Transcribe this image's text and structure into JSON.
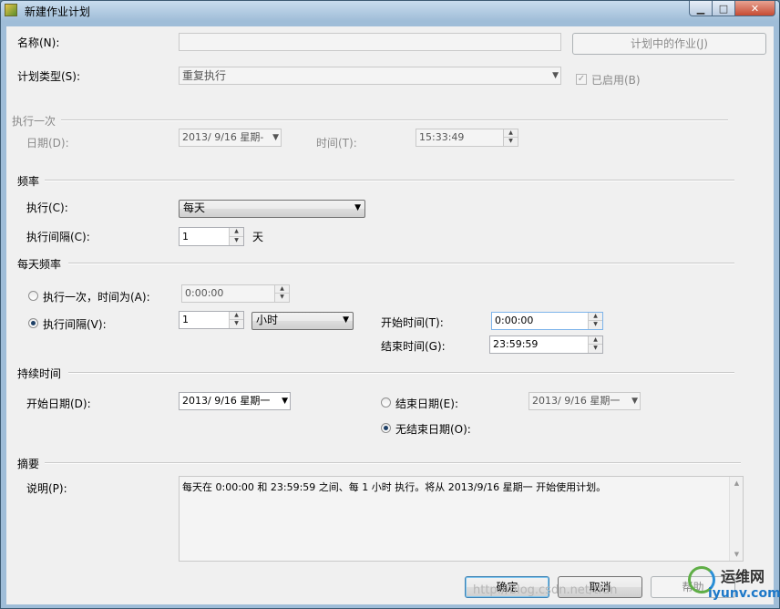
{
  "window": {
    "title": "新建作业计划",
    "minimize": "▁",
    "maximize": "□",
    "close": "✕"
  },
  "general": {
    "name_label": "名称(N):",
    "name_value": "",
    "jobs_button": "计划中的作业(J)",
    "schedule_type_label": "计划类型(S):",
    "schedule_type_value": "重复执行",
    "enabled_label": "已启用(B)",
    "enabled_checked": true
  },
  "once": {
    "section": "执行一次",
    "date_label": "日期(D):",
    "date_value": "2013/ 9/16 星期-",
    "time_label": "时间(T):",
    "time_value": "15:33:49"
  },
  "frequency": {
    "section": "频率",
    "occurs_label": "执行(C):",
    "occurs_value": "每天",
    "recur_label": "执行间隔(C):",
    "recur_value": "1",
    "recur_unit": "天"
  },
  "daily": {
    "section": "每天频率",
    "once_label": "执行一次，时间为(A):",
    "once_value": "0:00:00",
    "every_label": "执行间隔(V):",
    "every_value": "1",
    "every_unit": "小时",
    "start_label": "开始时间(T):",
    "start_value": "0:00:00",
    "end_label": "结束时间(G):",
    "end_value": "23:59:59",
    "selected": "every"
  },
  "duration": {
    "section": "持续时间",
    "start_date_label": "开始日期(D):",
    "start_date_value": "2013/ 9/16 星期一",
    "end_date_label": "结束日期(E):",
    "end_date_value": "2013/ 9/16 星期一",
    "no_end_label": "无结束日期(O):",
    "selected": "no_end"
  },
  "summary": {
    "section": "摘要",
    "desc_label": "说明(P):",
    "desc_value": "每天在 0:00:00 和 23:59:59 之间、每 1 小时 执行。将从 2013/9/16 星期一 开始使用计划。"
  },
  "buttons": {
    "ok": "确定",
    "cancel": "取消",
    "help": "帮助"
  },
  "watermark": {
    "url": "http://blog.csdn.net/tfdn",
    "logo_cn": "运维网",
    "logo_en": "iyunv.com"
  },
  "icons": {
    "app": "app-icon",
    "combo": "combo-arrow-icon",
    "spin": "spin-arrows-icon"
  }
}
